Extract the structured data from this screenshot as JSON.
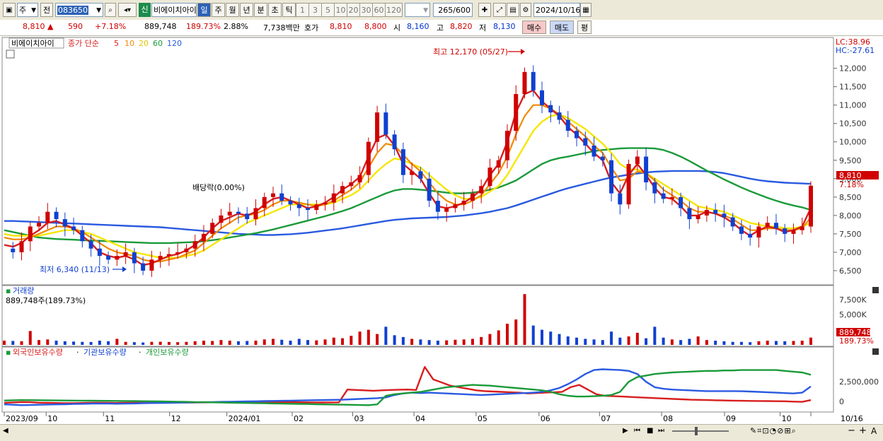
{
  "toolbar": {
    "period_type": "주",
    "code_label": "전",
    "stock_code": "083650",
    "market_badge": "신",
    "stock_name": "비에이치아이",
    "periods": [
      "일",
      "주",
      "월",
      "년",
      "분",
      "초",
      "틱"
    ],
    "selected_period": "일",
    "intervals": [
      "1",
      "3",
      "5",
      "10",
      "20",
      "30",
      "60",
      "120"
    ],
    "count_value": "265",
    "count_total": "/600",
    "date": "2024/10/16"
  },
  "quote": {
    "price": "8,810",
    "change": "590",
    "change_pct": "+7.18%",
    "volume": "889,748",
    "volume_ratio": "189.73%",
    "turnover": "2.88%",
    "amount": "7,738백만",
    "hoga_label": "호가",
    "hoga_ask": "8,810",
    "hoga_bid": "8,800",
    "open_label": "시",
    "open": "8,160",
    "high_label": "고",
    "high": "8,820",
    "low_label": "저",
    "low": "8,130",
    "buy_label": "매수",
    "sell_label": "매도",
    "avg_label": "평"
  },
  "colors": {
    "up": "#d00000",
    "down": "#1040d0",
    "ma5": "#d81e1e",
    "ma10": "#f08a00",
    "ma20": "#f5e600",
    "ma60": "#1a9a3a",
    "ma120": "#2a5ae0"
  },
  "chart_data": [
    {
      "type": "candlestick",
      "title": "비에이치아이",
      "legend_prefix": "종가 단순",
      "ma_periods": [
        "5",
        "10",
        "20",
        "60",
        "120"
      ],
      "corner_labels": {
        "lc": "LC:38.96",
        "hc": "HC:-27.61"
      },
      "y_ticks": [
        "6,500",
        "7,000",
        "7,500",
        "8,000",
        "8,500",
        "9,000",
        "9,500",
        "10,000",
        "10,500",
        "11,000",
        "11,500",
        "12,000"
      ],
      "ylim": [
        6000,
        12300
      ],
      "x_ticks": [
        "2023/09",
        "10",
        "11",
        "12",
        "2024/01",
        "02",
        "03",
        "04",
        "05",
        "06",
        "07",
        "08",
        "09",
        "10",
        "10/16"
      ],
      "annotations": {
        "high": "최고 12,170 (05/27)",
        "low": "최저 6,340 (11/13)",
        "dividend": "배당락(0.00%)"
      },
      "last_price_label": "8,810",
      "last_pct_label": "7.18%",
      "close_path": [
        7100,
        7000,
        7300,
        7700,
        7800,
        8100,
        7900,
        7700,
        7600,
        7300,
        7100,
        6900,
        6800,
        6900,
        7000,
        6700,
        6500,
        6800,
        6900,
        6950,
        7000,
        7100,
        7300,
        7500,
        7800,
        8000,
        8100,
        8050,
        7900,
        8200,
        8500,
        8600,
        8400,
        8300,
        8200,
        8150,
        8300,
        8350,
        8600,
        8800,
        8900,
        9100,
        10000,
        10800,
        10200,
        9800,
        9100,
        9200,
        9000,
        8400,
        8100,
        8200,
        8300,
        8400,
        8600,
        8800,
        9300,
        9500,
        10300,
        11300,
        11900,
        11400,
        11000,
        10800,
        10600,
        10300,
        10100,
        9900,
        9600,
        9500,
        8600,
        8300,
        9400,
        9600,
        8900,
        8600,
        8450,
        8500,
        8200,
        7900,
        8000,
        8150,
        8050,
        7950,
        7700,
        7500,
        7400,
        7700,
        7800,
        7650,
        7500,
        7600,
        7700,
        8810
      ],
      "ma5": [
        7200,
        7150,
        7250,
        7450,
        7600,
        7800,
        7850,
        7750,
        7650,
        7450,
        7250,
        7000,
        6900,
        6850,
        6900,
        6800,
        6650,
        6700,
        6800,
        6900,
        6950,
        7050,
        7200,
        7400,
        7650,
        7850,
        7950,
        8050,
        8000,
        8100,
        8300,
        8450,
        8500,
        8400,
        8300,
        8200,
        8250,
        8350,
        8500,
        8700,
        8850,
        9050,
        9600,
        10100,
        10200,
        9900,
        9400,
        9200,
        9000,
        8600,
        8250,
        8200,
        8250,
        8350,
        8500,
        8700,
        9100,
        9400,
        10000,
        10800,
        11300,
        11400,
        11100,
        10900,
        10700,
        10400,
        10200,
        9950,
        9700,
        9500,
        8900,
        8600,
        9100,
        9400,
        9100,
        8750,
        8500,
        8450,
        8250,
        8000,
        8000,
        8100,
        8050,
        7950,
        7800,
        7600,
        7450,
        7600,
        7700,
        7650,
        7550,
        7600,
        7700,
        8200
      ],
      "ma10": [
        7400,
        7350,
        7350,
        7400,
        7500,
        7600,
        7700,
        7700,
        7650,
        7550,
        7400,
        7250,
        7100,
        7000,
        6950,
        6900,
        6800,
        6750,
        6750,
        6800,
        6850,
        6950,
        7050,
        7250,
        7450,
        7650,
        7800,
        7950,
        8000,
        8050,
        8150,
        8300,
        8400,
        8400,
        8350,
        8300,
        8250,
        8300,
        8400,
        8550,
        8700,
        8900,
        9300,
        9700,
        9950,
        9900,
        9650,
        9400,
        9200,
        8900,
        8600,
        8400,
        8300,
        8300,
        8400,
        8550,
        8850,
        9150,
        9600,
        10200,
        10700,
        11000,
        11000,
        10900,
        10750,
        10550,
        10350,
        10150,
        9900,
        9700,
        9300,
        8950,
        9000,
        9200,
        9150,
        8950,
        8700,
        8550,
        8400,
        8200,
        8100,
        8100,
        8050,
        8000,
        7900,
        7750,
        7600,
        7600,
        7650,
        7650,
        7600,
        7600,
        7650,
        7950
      ],
      "ma20": [
        7500,
        7450,
        7450,
        7450,
        7450,
        7500,
        7550,
        7600,
        7600,
        7550,
        7500,
        7400,
        7300,
        7200,
        7100,
        7000,
        6950,
        6900,
        6850,
        6850,
        6850,
        6900,
        6950,
        7050,
        7200,
        7350,
        7500,
        7650,
        7800,
        7900,
        8000,
        8100,
        8200,
        8300,
        8300,
        8300,
        8300,
        8300,
        8350,
        8450,
        8550,
        8700,
        8950,
        9200,
        9400,
        9550,
        9500,
        9400,
        9300,
        9100,
        8900,
        8700,
        8550,
        8450,
        8450,
        8500,
        8650,
        8800,
        9100,
        9500,
        9900,
        10300,
        10550,
        10700,
        10750,
        10650,
        10500,
        10350,
        10150,
        9950,
        9700,
        9400,
        9250,
        9250,
        9150,
        9000,
        8850,
        8700,
        8550,
        8400,
        8250,
        8200,
        8150,
        8100,
        8000,
        7900,
        7800,
        7750,
        7700,
        7700,
        7650,
        7650,
        7700,
        7800
      ],
      "ma60": [
        7600,
        7550,
        7500,
        7450,
        7400,
        7380,
        7360,
        7350,
        7340,
        7330,
        7320,
        7310,
        7300,
        7290,
        7280,
        7270,
        7260,
        7250,
        7250,
        7250,
        7260,
        7270,
        7280,
        7300,
        7330,
        7360,
        7400,
        7440,
        7480,
        7520,
        7570,
        7620,
        7680,
        7740,
        7800,
        7860,
        7920,
        7980,
        8050,
        8120,
        8200,
        8300,
        8400,
        8500,
        8600,
        8680,
        8720,
        8720,
        8700,
        8680,
        8650,
        8620,
        8600,
        8600,
        8620,
        8650,
        8700,
        8760,
        8850,
        8950,
        9100,
        9250,
        9400,
        9500,
        9560,
        9600,
        9650,
        9700,
        9750,
        9780,
        9800,
        9820,
        9830,
        9830,
        9830,
        9820,
        9780,
        9700,
        9600,
        9480,
        9350,
        9220,
        9100,
        8980,
        8870,
        8760,
        8660,
        8570,
        8480,
        8400,
        8330,
        8270,
        8220,
        8150
      ],
      "ma120": [
        7850,
        7850,
        7840,
        7830,
        7820,
        7810,
        7800,
        7790,
        7780,
        7770,
        7760,
        7750,
        7740,
        7730,
        7720,
        7710,
        7700,
        7690,
        7680,
        7660,
        7640,
        7620,
        7600,
        7580,
        7560,
        7540,
        7520,
        7500,
        7490,
        7480,
        7470,
        7470,
        7480,
        7490,
        7510,
        7530,
        7560,
        7590,
        7620,
        7650,
        7690,
        7730,
        7770,
        7810,
        7850,
        7880,
        7900,
        7920,
        7930,
        7940,
        7950,
        7960,
        7980,
        8000,
        8030,
        8060,
        8100,
        8150,
        8200,
        8270,
        8350,
        8430,
        8510,
        8590,
        8670,
        8740,
        8800,
        8860,
        8920,
        8980,
        9030,
        9070,
        9110,
        9140,
        9170,
        9190,
        9200,
        9210,
        9210,
        9210,
        9210,
        9200,
        9180,
        9150,
        9100,
        9050,
        9000,
        8960,
        8930,
        8910,
        8890,
        8880,
        8870,
        8860
      ]
    },
    {
      "type": "bar",
      "title": "거래량",
      "summary": "889,748주(189.73%)",
      "y_ticks": [
        "5,000K",
        "7,500K"
      ],
      "ylim": [
        0,
        9000
      ],
      "last_label": "889,748",
      "last_pct_label": "189.73%",
      "values_k": [
        700,
        650,
        600,
        2300,
        800,
        900,
        700,
        600,
        550,
        500,
        480,
        700,
        600,
        1000,
        500,
        450,
        400,
        500,
        520,
        480,
        450,
        500,
        600,
        700,
        650,
        800,
        700,
        600,
        650,
        700,
        900,
        1000,
        850,
        700,
        1000,
        800,
        750,
        900,
        1200,
        1100,
        1500,
        2200,
        2500,
        1800,
        3000,
        1600,
        1300,
        1000,
        900,
        800,
        700,
        750,
        850,
        900,
        1000,
        1300,
        1800,
        2400,
        3500,
        4200,
        8400,
        3200,
        2500,
        2200,
        1800,
        1400,
        1200,
        1000,
        900,
        800,
        2200,
        1200,
        1400,
        2000,
        1100,
        3000,
        1200,
        900,
        800,
        1000,
        1400,
        800,
        700,
        600,
        500,
        500,
        450,
        600,
        700,
        650,
        600,
        650,
        700,
        1200
      ]
    },
    {
      "type": "line",
      "series": [
        {
          "name": "외국인보유수량",
          "values": [
            -200000,
            -150000,
            -100000,
            -120000,
            -180000,
            -200000,
            -220000,
            -250000,
            -240000,
            -220000,
            -200000,
            -180000,
            -200000,
            -220000,
            -200000,
            -180000,
            -160000,
            -150000,
            -140000,
            -150000,
            -160000,
            -170000,
            -160000,
            -150000,
            -140000,
            -130000,
            -120000,
            -110000,
            -100000,
            -90000,
            -90000,
            -100000,
            -110000,
            -120000,
            -130000,
            -140000,
            -150000,
            -160000,
            -150000,
            -140000,
            1500000,
            1450000,
            1400000,
            1350000,
            1400000,
            1450000,
            1480000,
            1500000,
            1450000,
            4400000,
            2800000,
            2400000,
            2000000,
            1800000,
            1600000,
            1400000,
            1300000,
            1250000,
            1200000,
            1150000,
            1100000,
            1000000,
            1050000,
            1100000,
            1150000,
            1200000,
            1800000,
            2100000,
            1500000,
            900000,
            700000,
            650000,
            600000,
            550000,
            500000,
            450000,
            400000,
            350000,
            300000,
            250000,
            200000,
            180000,
            150000,
            120000,
            100000,
            80000,
            60000,
            40000,
            30000,
            20000,
            10000,
            0,
            -50000,
            -80000,
            150000
          ]
        },
        {
          "name": "기관보유수량",
          "values": [
            -400000,
            -450000,
            -500000,
            -480000,
            -450000,
            -420000,
            -400000,
            -380000,
            -350000,
            -330000,
            -300000,
            -280000,
            -300000,
            -320000,
            -300000,
            -280000,
            -250000,
            -230000,
            -220000,
            -200000,
            -180000,
            -160000,
            -140000,
            -120000,
            -100000,
            -80000,
            -60000,
            -40000,
            -20000,
            0,
            20000,
            40000,
            60000,
            80000,
            100000,
            120000,
            140000,
            160000,
            180000,
            200000,
            250000,
            300000,
            350000,
            400000,
            500000,
            800000,
            1000000,
            1100000,
            1050000,
            1100000,
            1050000,
            1000000,
            950000,
            900000,
            850000,
            800000,
            850000,
            900000,
            950000,
            1000000,
            1050000,
            1100000,
            1200000,
            1400000,
            1700000,
            2200000,
            2800000,
            3500000,
            4000000,
            4100000,
            4050000,
            4000000,
            3900000,
            3500000,
            2500000,
            1800000,
            1600000,
            1500000,
            1450000,
            1400000,
            1350000,
            1300000,
            1300000,
            1300000,
            1300000,
            1280000,
            1250000,
            1200000,
            1150000,
            1100000,
            1050000,
            1000000,
            1100000,
            1900000
          ]
        },
        {
          "name": "개인보유수량",
          "values": [
            100000,
            120000,
            150000,
            140000,
            130000,
            120000,
            110000,
            100000,
            90000,
            80000,
            70000,
            60000,
            50000,
            40000,
            30000,
            20000,
            10000,
            0,
            -20000,
            -40000,
            -60000,
            -80000,
            -100000,
            -120000,
            -140000,
            -160000,
            -180000,
            -200000,
            -220000,
            -240000,
            -260000,
            -280000,
            -300000,
            -320000,
            -340000,
            -360000,
            -380000,
            -400000,
            -420000,
            -440000,
            -460000,
            -480000,
            -500000,
            -400000,
            700000,
            900000,
            1000000,
            1100000,
            1200000,
            1400000,
            1600000,
            1800000,
            1900000,
            2000000,
            2100000,
            2050000,
            2000000,
            1900000,
            1800000,
            1700000,
            1600000,
            1500000,
            1400000,
            1200000,
            900000,
            700000,
            600000,
            600000,
            650000,
            700000,
            800000,
            1200000,
            2500000,
            3100000,
            3300000,
            3500000,
            3600000,
            3700000,
            3750000,
            3800000,
            3850000,
            3900000,
            3900000,
            3950000,
            3950000,
            4000000,
            4000000,
            4000000,
            4000000,
            4000000,
            3900000,
            3800000,
            3700000,
            3400000
          ]
        }
      ],
      "y_ticks": [
        "0",
        "2,500,000"
      ],
      "ylim": [
        -1200000,
        5600000
      ]
    }
  ]
}
